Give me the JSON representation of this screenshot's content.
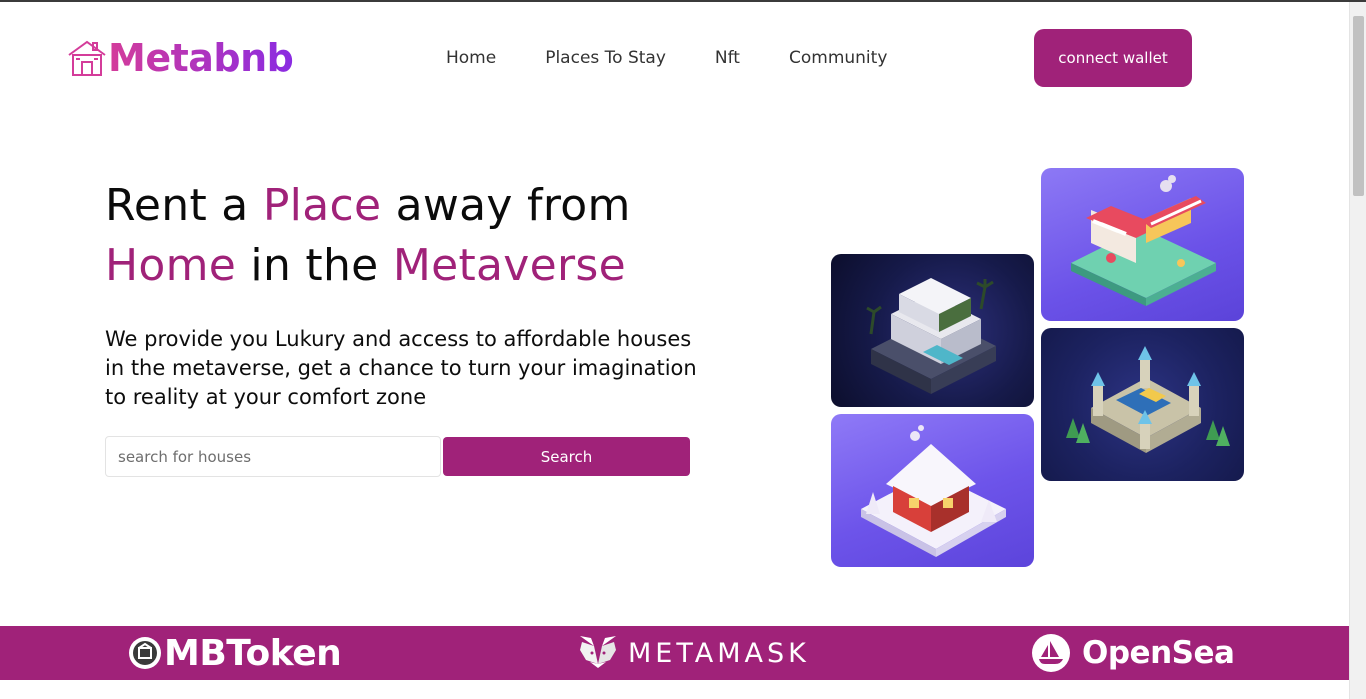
{
  "header": {
    "logo_text": "Metabnb",
    "nav": [
      {
        "label": "Home"
      },
      {
        "label": "Places To Stay"
      },
      {
        "label": "Nft"
      },
      {
        "label": "Community"
      }
    ],
    "connect_label": "connect wallet"
  },
  "hero": {
    "title_parts": {
      "p1": "Rent a ",
      "p2": "Place",
      "p3": " away from",
      "p4": "Home",
      "p5": " in the ",
      "p6": "Metaverse"
    },
    "description": "We provide you Lukury and access to affordable houses in the metaverse, get a chance to turn your imagination to reality at your comfort zone",
    "search_placeholder": "search for houses",
    "search_label": "Search"
  },
  "partners": {
    "mbtoken": "MBToken",
    "metamask": "METAMASK",
    "opensea": "OpenSea"
  },
  "colors": {
    "accent": "#a02279",
    "logo_gradient_start": "#d43c9a",
    "logo_gradient_end": "#8a2be2"
  },
  "icons": [
    "house-logo-icon",
    "mbtoken-coin-icon",
    "metamask-fox-icon",
    "opensea-boat-icon"
  ]
}
